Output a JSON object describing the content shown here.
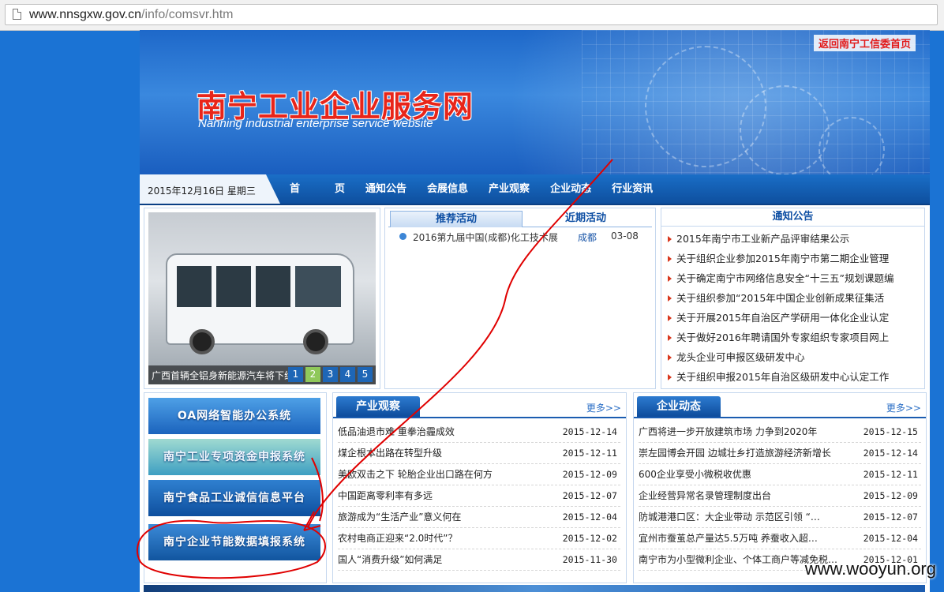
{
  "browser": {
    "url_host": "www.nnsgxw.gov.cn",
    "url_path": "/info/comsvr.htm"
  },
  "header": {
    "return_link": "返回南宁工信委首页",
    "site_title": "南宁工业企业服务网",
    "site_subtitle": "Nanning industrial enterprise service website",
    "accent_red": "#e8251a",
    "nav_blue": "#0e4f9e"
  },
  "nav": {
    "date": "2015年12月16日 星期三",
    "items": [
      "首页",
      "通知公告",
      "会展信息",
      "产业观察",
      "企业动态",
      "行业资讯"
    ]
  },
  "slider": {
    "caption": "广西首辆全铝身新能源汽车将下线",
    "pages": [
      "1",
      "2",
      "3",
      "4",
      "5"
    ],
    "active_page": "2"
  },
  "activity": {
    "tabs": [
      "推荐活动",
      "近期活动"
    ],
    "items": [
      {
        "title": "2016第九届中国(成都)化工技术展",
        "city": "成都",
        "date": "03-08"
      }
    ]
  },
  "notice": {
    "title": "通知公告",
    "items": [
      "2015年南宁市工业新产品评审结果公示",
      "关于组织企业参加2015年南宁市第二期企业管理",
      "关于确定南宁市网络信息安全“十三五”规划课题编",
      "关于组织参加“2015年中国企业创新成果征集活",
      "关于开展2015年自治区产学研用一体化企业认定",
      "关于做好2016年聘请国外专家组织专家项目网上",
      "龙头企业可申报区级研发中心",
      "关于组织申报2015年自治区级研发中心认定工作"
    ]
  },
  "systems": [
    "OA网络智能办公系统",
    "南宁工业专项资金申报系统",
    "南宁食品工业诚信信息平台",
    "南宁企业节能数据填报系统"
  ],
  "industry": {
    "title": "产业观察",
    "more": "更多>>",
    "items": [
      {
        "title": "低品油退市难 重拳治霾成效",
        "date": "2015-12-14"
      },
      {
        "title": "煤企根本出路在转型升级",
        "date": "2015-12-11"
      },
      {
        "title": "美欧双击之下 轮胎企业出口路在何方",
        "date": "2015-12-09"
      },
      {
        "title": "中国距离零利率有多远",
        "date": "2015-12-07"
      },
      {
        "title": "旅游成为“生活产业”意义何在",
        "date": "2015-12-04"
      },
      {
        "title": "农村电商正迎来“2.0时代”？",
        "date": "2015-12-02"
      },
      {
        "title": "国人“消费升级”如何满足",
        "date": "2015-11-30"
      }
    ]
  },
  "company": {
    "title": "企业动态",
    "more": "更多>>",
    "items": [
      {
        "title": "广西将进一步开放建筑市场 力争到2020年",
        "date": "2015-12-15"
      },
      {
        "title": "崇左园博会开园 边城壮乡打造旅游经济新增长",
        "date": "2015-12-14"
      },
      {
        "title": "600企业享受小微税收优惠",
        "date": "2015-12-11"
      },
      {
        "title": "企业经营异常名录管理制度出台",
        "date": "2015-12-09"
      },
      {
        "title": "防城港港口区：大企业带动 示范区引领 “…",
        "date": "2015-12-07"
      },
      {
        "title": "宜州市蚕茧总产量达5.5万吨 养蚕收入超…",
        "date": "2015-12-04"
      },
      {
        "title": "南宁市为小型微利企业、个体工商户等减免税…",
        "date": "2015-12-01"
      }
    ]
  },
  "watermark": "www.wooyun.org",
  "annotation_color": "#e00000"
}
